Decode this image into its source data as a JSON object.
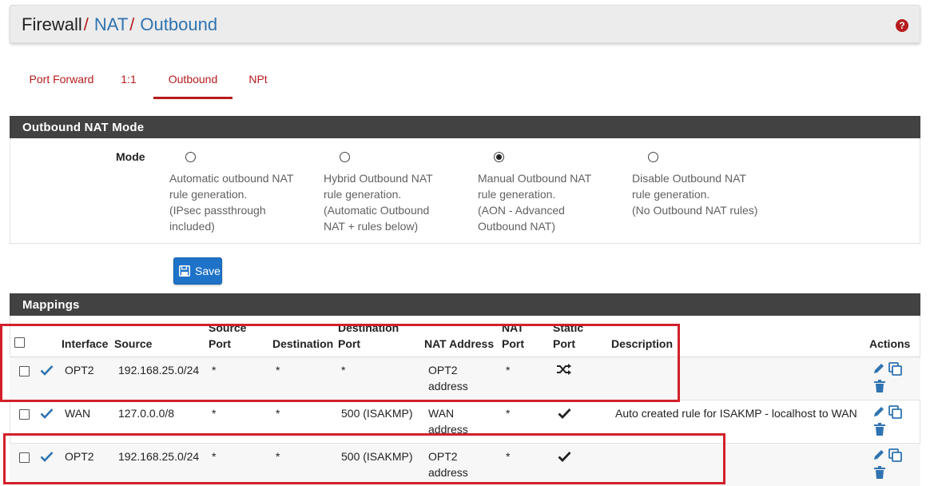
{
  "breadcrumb": {
    "items": [
      "Firewall",
      "NAT",
      "Outbound"
    ],
    "separator": "/"
  },
  "help": {
    "glyph": "?"
  },
  "tabs": [
    {
      "label": "Port Forward",
      "active": false
    },
    {
      "label": "1:1",
      "active": false
    },
    {
      "label": "Outbound",
      "active": true
    },
    {
      "label": "NPt",
      "active": false
    }
  ],
  "mode_panel": {
    "title": "Outbound NAT Mode",
    "label": "Mode",
    "options": [
      {
        "text": "Automatic outbound NAT\nrule generation.\n(IPsec passthrough\nincluded)",
        "checked": false
      },
      {
        "text": "Hybrid Outbound NAT\nrule generation.\n(Automatic Outbound\nNAT + rules below)",
        "checked": false
      },
      {
        "text": "Manual Outbound NAT\nrule generation.\n(AON - Advanced\nOutbound NAT)",
        "checked": true
      },
      {
        "text": "Disable Outbound NAT\nrule generation.\n(No Outbound NAT rules)",
        "checked": false
      }
    ]
  },
  "save_button": {
    "label": "Save",
    "icon": "floppy-disk-icon"
  },
  "mappings": {
    "title": "Mappings",
    "columns": {
      "interface": "Interface",
      "source": "Source",
      "source_port_1": "Source",
      "source_port_2": "Port",
      "destination": "Destination",
      "destination_port_1": "Destination",
      "destination_port_2": "Port",
      "nat_address": "NAT Address",
      "nat_port_1": "NAT",
      "nat_port_2": "Port",
      "static_port_1": "Static",
      "static_port_2": "Port",
      "description": "Description",
      "actions": "Actions"
    },
    "rows": [
      {
        "interface": "OPT2",
        "source": "192.168.25.0/24",
        "source_port": "*",
        "destination": "*",
        "destination_port": "*",
        "nat_address": "OPT2 address",
        "nat_port": "*",
        "static_port": "shuffle-icon",
        "description": ""
      },
      {
        "interface": "WAN",
        "source": "127.0.0.0/8",
        "source_port": "*",
        "destination": "*",
        "destination_port": "500 (ISAKMP)",
        "nat_address": "WAN address",
        "nat_port": "*",
        "static_port": "check-icon",
        "description": "Auto created rule for ISAKMP - localhost to WAN"
      },
      {
        "interface": "OPT2",
        "source": "192.168.25.0/24",
        "source_port": "*",
        "destination": "*",
        "destination_port": "500 (ISAKMP)",
        "nat_address": "OPT2 address",
        "nat_port": "*",
        "static_port": "check-icon",
        "description": ""
      }
    ]
  },
  "colors": {
    "accent": "#b71c1c",
    "link": "#2f73b0",
    "button": "#1e73c8",
    "panel_header": "#424242",
    "annotation": "#d2202a"
  }
}
